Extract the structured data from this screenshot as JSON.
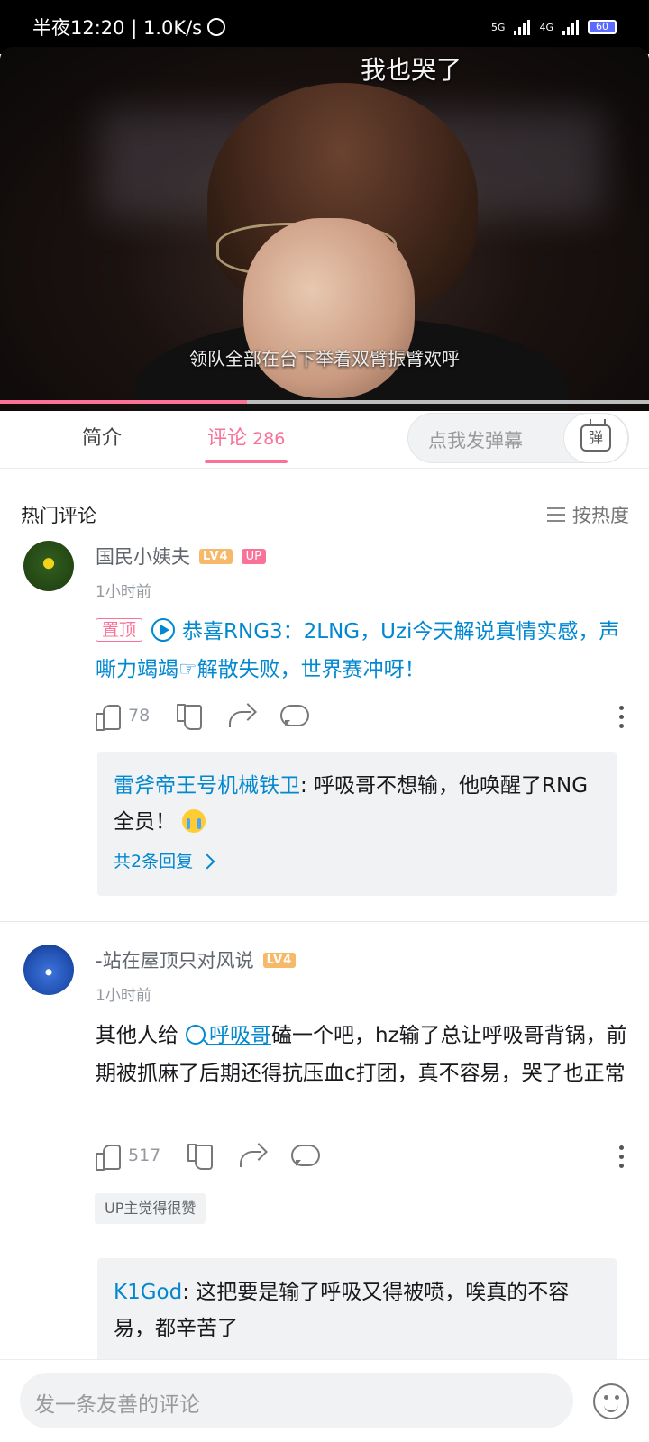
{
  "status_bar": {
    "time_speed": "半夜12:20 | 1.0K/s",
    "net1": "5G",
    "net2": "4G",
    "battery": "60"
  },
  "video": {
    "caption_top": "我也哭了",
    "caption_bottom": "领队全部在台下举着双臂振臂欢呼",
    "progress_fraction": 0.38
  },
  "tabs": {
    "intro": "简介",
    "comments": "评论",
    "comments_count": "286",
    "danmaku_placeholder": "点我发弹幕",
    "danmaku_button": "弹"
  },
  "hot": {
    "title": "热门评论",
    "sort_label": "按热度"
  },
  "comments": [
    {
      "username": "国民小姨夫",
      "level": "LV4",
      "up_badge": "UP",
      "time": "1小时前",
      "pin_label": "置顶",
      "text": "恭喜RNG3：2LNG，Uzi今天解说真情实感，声嘶力竭竭☞解散失败，世界赛冲呀！",
      "likes": "78",
      "reply": {
        "author": "雷斧帝王号机械铁卫",
        "text": ": 呼吸哥不想输，他唤醒了RNG全员！",
        "more": "共2条回复"
      }
    },
    {
      "username": "-站在屋顶只对风说",
      "level": "LV4",
      "time": "1小时前",
      "text_before": "其他人给",
      "search_link": "呼吸哥",
      "text_after": "磕一个吧，hz输了总让呼吸哥背锅，前期被抓麻了后期还得抗压血c打团，真不容易，哭了也正常",
      "likes": "517",
      "up_liked": "UP主觉得很赞",
      "reply": {
        "author": "K1God",
        "text": ": 这把要是输了呼吸又得被喷，唉真的不容易，都辛苦了"
      }
    }
  ],
  "bottom": {
    "input_placeholder": "发一条友善的评论"
  },
  "colors": {
    "accent": "#fb7299",
    "link": "#0288d1"
  }
}
